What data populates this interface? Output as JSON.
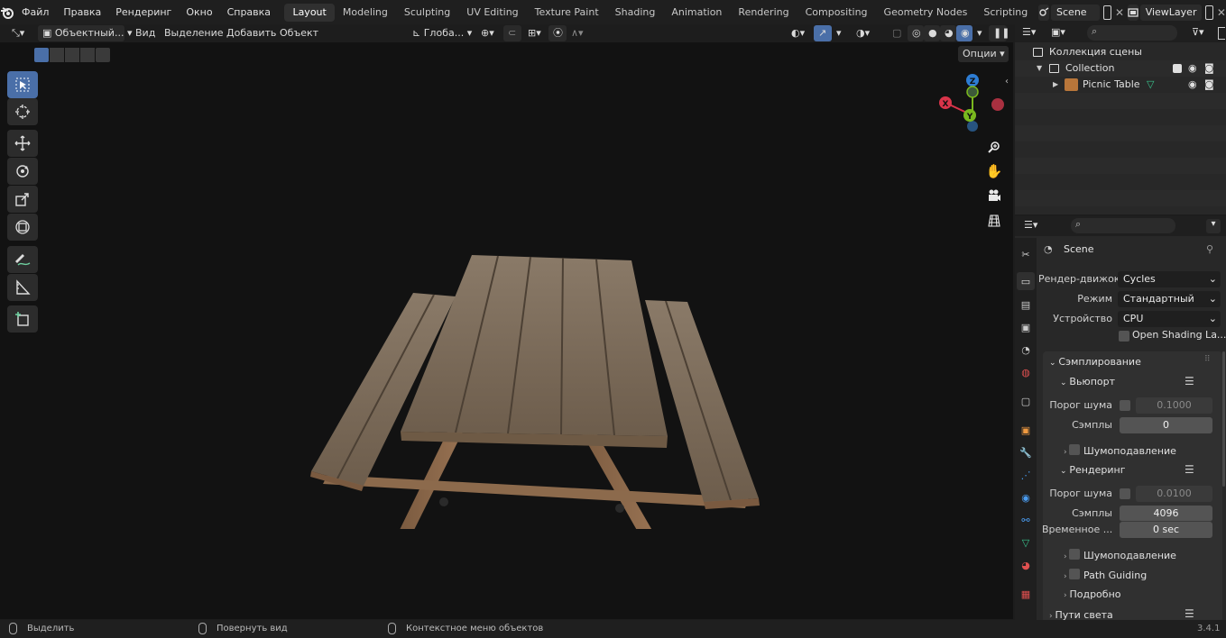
{
  "topbar": {
    "menu": [
      "Файл",
      "Правка",
      "Рендеринг",
      "Окно",
      "Справка"
    ],
    "workspaces": [
      "Layout",
      "Modeling",
      "Sculpting",
      "UV Editing",
      "Texture Paint",
      "Shading",
      "Animation",
      "Rendering",
      "Compositing",
      "Geometry Nodes",
      "Scripting"
    ],
    "active_workspace": "Layout",
    "scene_name": "Scene",
    "view_layer": "ViewLayer"
  },
  "viewport_header": {
    "mode": "Объектный...",
    "view": "Вид",
    "select": "Выделение",
    "add": "Добавить",
    "object": "Объект",
    "orientation": "Глоба...",
    "options": "Опции"
  },
  "gizmo": {
    "x": "X",
    "y": "Y",
    "z": "Z"
  },
  "outliner": {
    "search_placeholder": "",
    "scene_collection": "Коллекция сцены",
    "collection": "Collection",
    "object": "Picnic Table"
  },
  "properties": {
    "context": "Scene",
    "render_engine_label": "Рендер-движок",
    "render_engine": "Cycles",
    "mode_label": "Режим",
    "mode": "Стандартный",
    "device_label": "Устройство",
    "device": "CPU",
    "open_shading": "Open Shading La...",
    "sampling": "Сэмплирование",
    "viewport": "Вьюпорт",
    "noise_threshold_label": "Порог шума",
    "viewport_noise_threshold": "0.1000",
    "samples_label": "Сэмплы",
    "viewport_samples": "0",
    "denoise": "Шумоподавление",
    "render": "Рендеринг",
    "render_noise_threshold": "0.0100",
    "render_samples": "4096",
    "time_limit_label": "Временное ...",
    "time_limit": "0 sec",
    "path_guiding": "Path Guiding",
    "advanced": "Подробно",
    "light_paths": "Пути света"
  },
  "statusbar": {
    "select": "Выделить",
    "rotate": "Повернуть вид",
    "context_menu": "Контекстное меню объектов",
    "version": "3.4.1"
  },
  "colors": {
    "accent": "#4a6fa8",
    "axis_x": "#d9344a",
    "axis_y": "#7ab81e",
    "axis_z": "#2d7dd4",
    "wood": "#7a6a58"
  }
}
